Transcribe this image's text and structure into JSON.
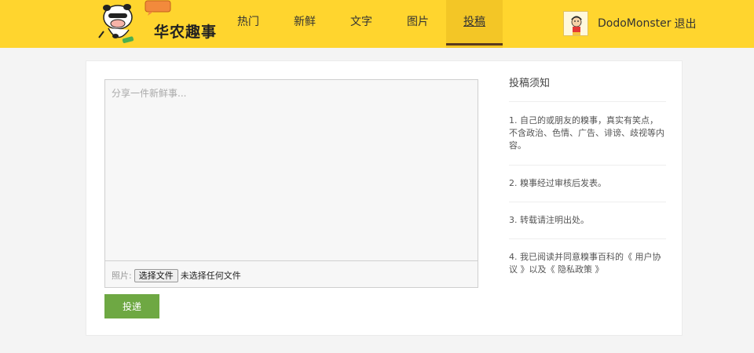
{
  "brand": {
    "name": "华农趣事"
  },
  "nav": [
    {
      "label": "热门",
      "active": false
    },
    {
      "label": "新鲜",
      "active": false
    },
    {
      "label": "文字",
      "active": false
    },
    {
      "label": "图片",
      "active": false
    },
    {
      "label": "投稿",
      "active": true
    }
  ],
  "user": {
    "name": "DodoMonster",
    "logout_label": "退出"
  },
  "editor": {
    "placeholder": "分享一件新鲜事...",
    "photo_label": "照片:",
    "file_button": "选择文件",
    "file_status": "未选择任何文件"
  },
  "submit_label": "投递",
  "notice": {
    "title": "投稿须知",
    "item1": "1. 自己的或朋友的糗事，真实有笑点，不含政治、色情、广告、诽谤、歧视等内容。",
    "item2": "2. 糗事经过审核后发表。",
    "item3": "3. 转载请注明出处。",
    "item4_prefix": "4. 我已阅读并同意糗事百科的",
    "item4_link1": "《 用户协议 》",
    "item4_mid": "以及",
    "item4_link2": "《 隐私政策 》"
  },
  "colors": {
    "header": "#ffd52e",
    "nav_active": "#f3c626",
    "submit": "#6ea843"
  }
}
